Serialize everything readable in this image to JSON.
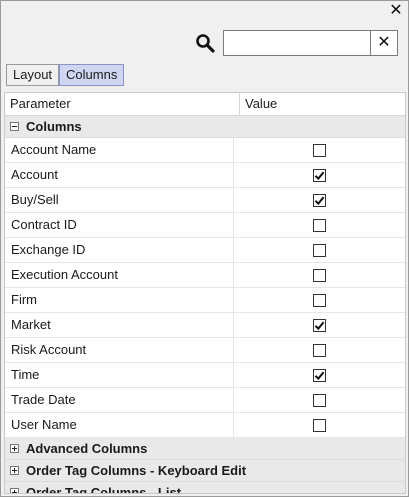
{
  "window": {
    "close_glyph": "✕"
  },
  "search": {
    "placeholder": "",
    "value": "",
    "clear_glyph": "✕"
  },
  "tabs": [
    {
      "label": "Layout",
      "active": false
    },
    {
      "label": "Columns",
      "active": true
    }
  ],
  "grid": {
    "headers": {
      "parameter": "Parameter",
      "value": "Value"
    },
    "groups": [
      {
        "label": "Columns",
        "expanded": true,
        "rows": [
          {
            "label": "Account Name",
            "checked": false
          },
          {
            "label": "Account",
            "checked": true
          },
          {
            "label": "Buy/Sell",
            "checked": true
          },
          {
            "label": "Contract ID",
            "checked": false
          },
          {
            "label": "Exchange ID",
            "checked": false
          },
          {
            "label": "Execution Account",
            "checked": false
          },
          {
            "label": "Firm",
            "checked": false
          },
          {
            "label": "Market",
            "checked": true
          },
          {
            "label": "Risk Account",
            "checked": false
          },
          {
            "label": "Time",
            "checked": true
          },
          {
            "label": "Trade Date",
            "checked": false
          },
          {
            "label": "User Name",
            "checked": false
          }
        ]
      },
      {
        "label": "Advanced Columns",
        "expanded": false,
        "rows": []
      },
      {
        "label": "Order Tag Columns - Keyboard Edit",
        "expanded": false,
        "rows": []
      },
      {
        "label": "Order Tag Columns - List",
        "expanded": false,
        "rows": []
      }
    ]
  },
  "icons": {
    "close": "close-icon",
    "search": "search-icon",
    "clear": "clear-icon",
    "collapse": "minus-box-icon",
    "expand": "plus-box-icon",
    "check": "checkmark-icon"
  },
  "colors": {
    "active_tab": "#cfd6f2",
    "group_bg": "#e9e9e9",
    "panel_bg": "#f0f0f0"
  }
}
